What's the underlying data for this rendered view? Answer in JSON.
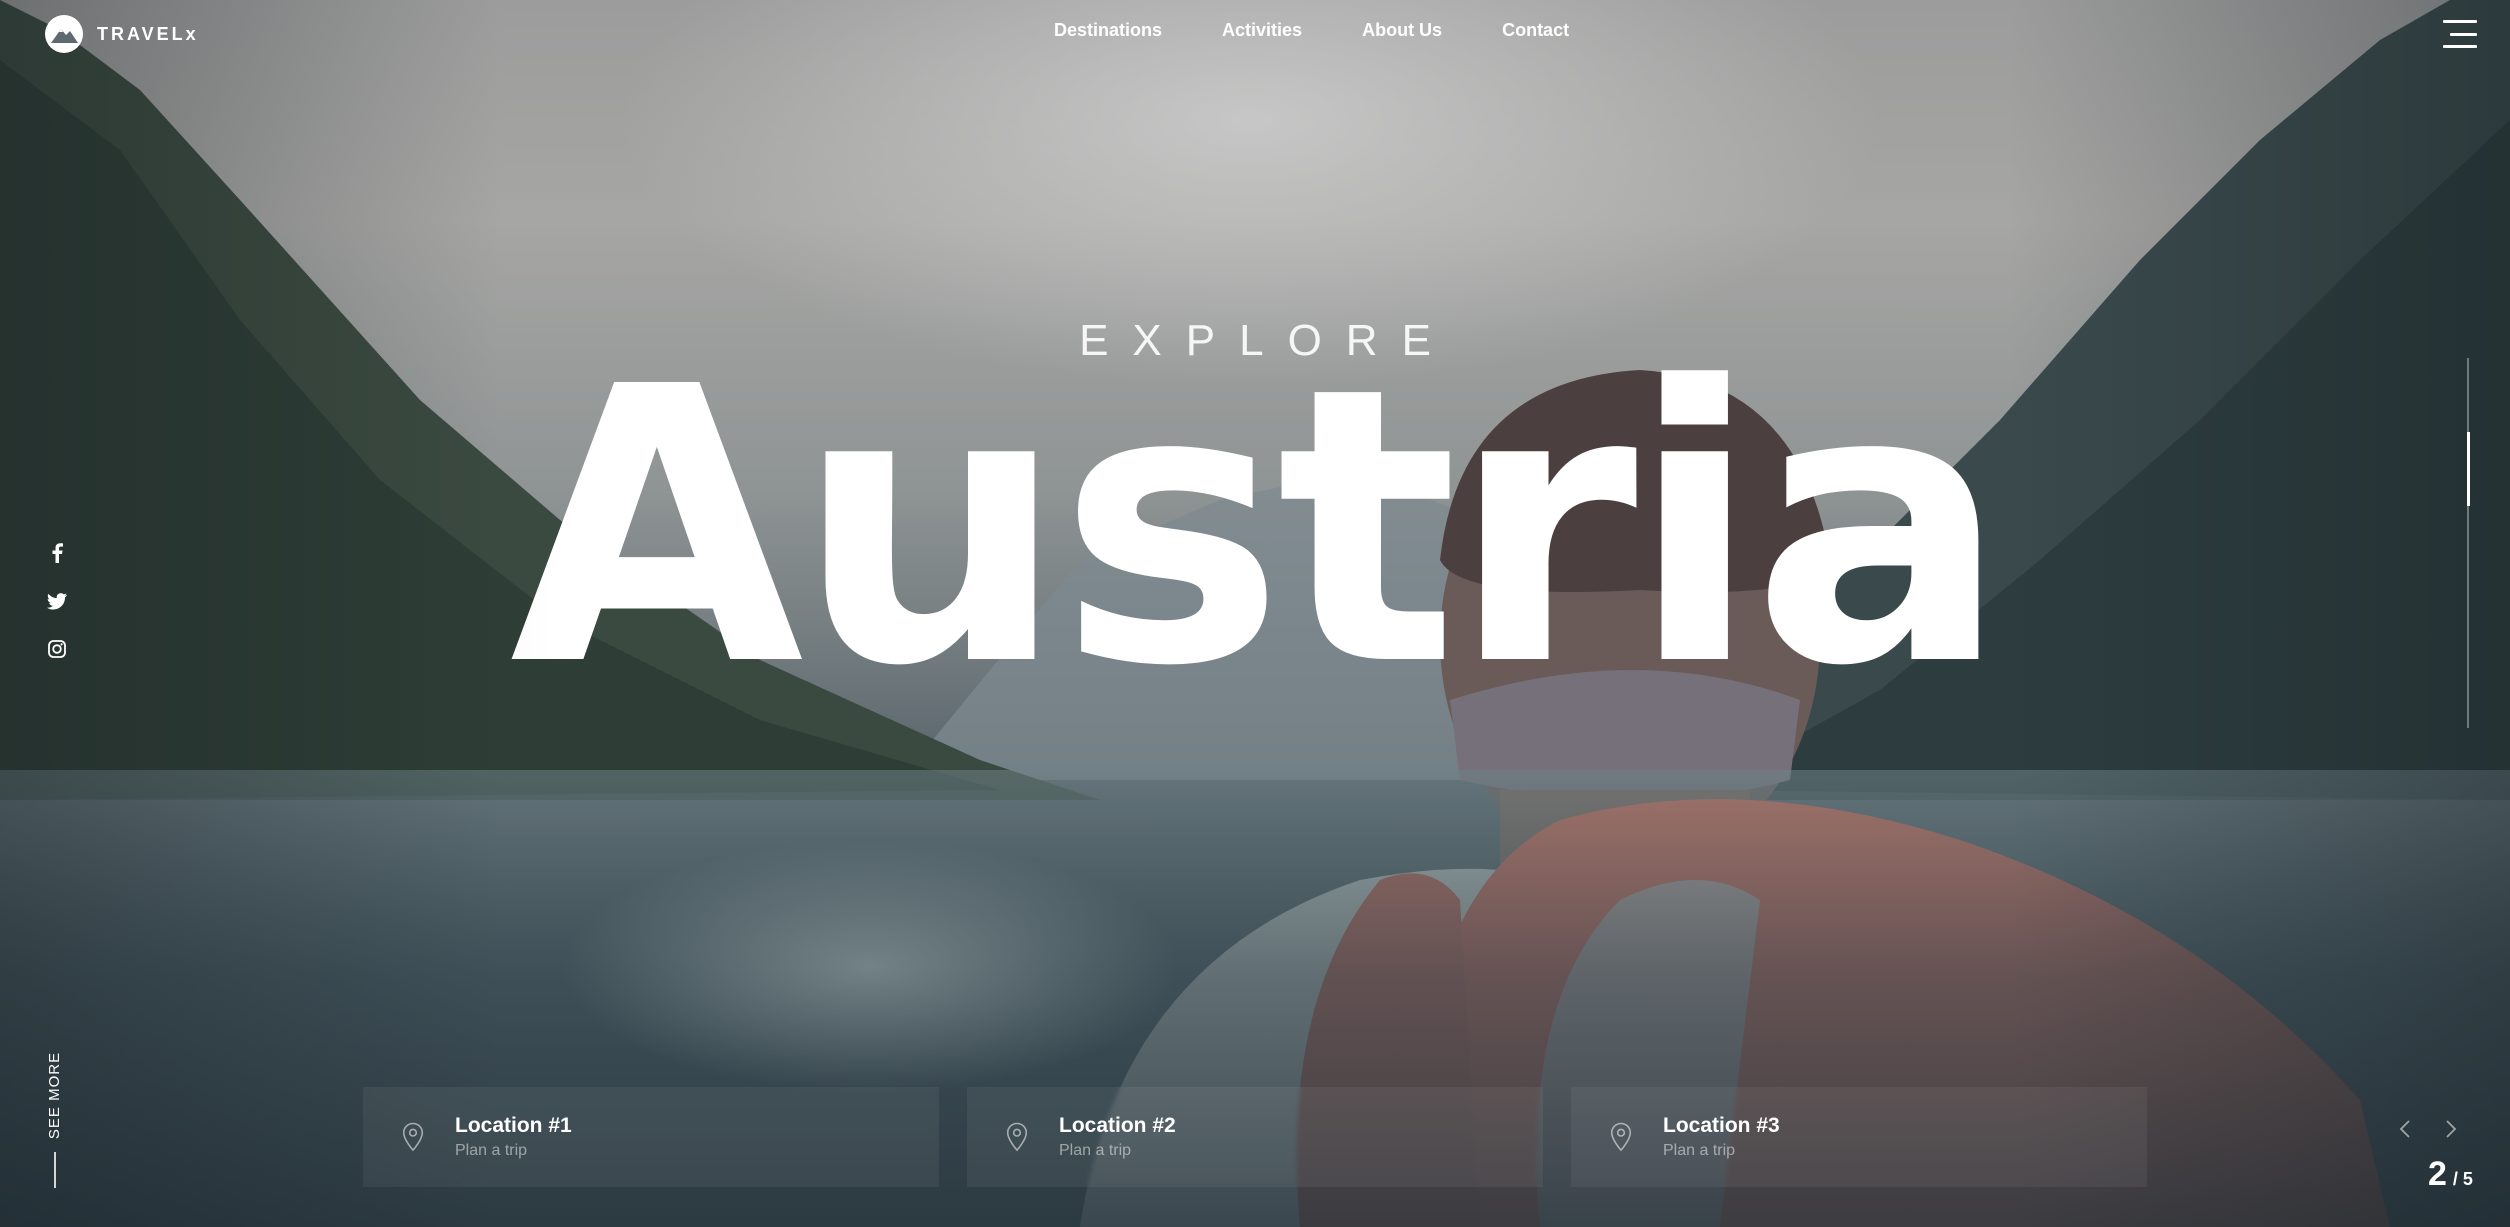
{
  "brand": {
    "name": "TRAVELx"
  },
  "nav": {
    "items": [
      {
        "label": "Destinations"
      },
      {
        "label": "Activities"
      },
      {
        "label": "About Us"
      },
      {
        "label": "Contact"
      }
    ]
  },
  "hero": {
    "eyebrow": "EXPLORE",
    "title": "Austria"
  },
  "social": {
    "icons": [
      "facebook-icon",
      "twitter-icon",
      "instagram-icon"
    ]
  },
  "see_more": {
    "label": "SEE MORE"
  },
  "locations": [
    {
      "title": "Location #1",
      "subtitle": "Plan a trip"
    },
    {
      "title": "Location #2",
      "subtitle": "Plan a trip"
    },
    {
      "title": "Location #3",
      "subtitle": "Plan a trip"
    }
  ],
  "slider": {
    "current": "2",
    "total": "/ 5",
    "progress_fraction": 0.2
  },
  "colors": {
    "text": "#ffffff",
    "backpack_accent": "#e0614a"
  }
}
